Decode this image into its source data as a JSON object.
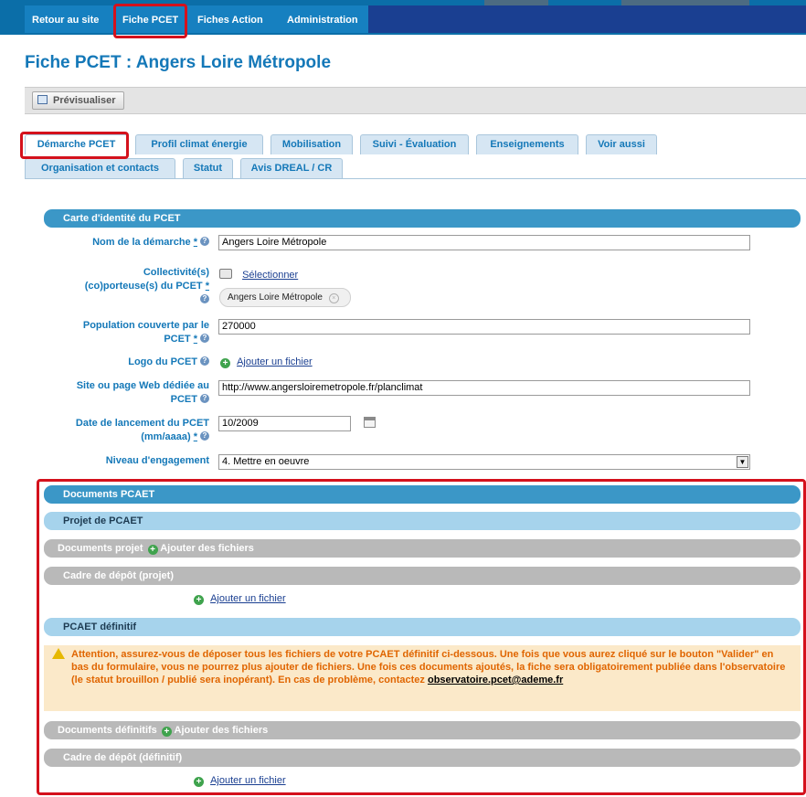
{
  "nav": {
    "items": [
      {
        "label": "Retour au site"
      },
      {
        "label": "Fiche PCET"
      },
      {
        "label": "Fiches Action"
      },
      {
        "label": "Administration"
      }
    ]
  },
  "page": {
    "title": "Fiche PCET : Angers Loire Métropole"
  },
  "toolbar": {
    "preview_label": "Prévisualiser"
  },
  "tabs": {
    "row1": [
      {
        "label": "Démarche PCET"
      },
      {
        "label": "Profil climat énergie"
      },
      {
        "label": "Mobilisation"
      },
      {
        "label": "Suivi - Évaluation"
      },
      {
        "label": "Enseignements"
      },
      {
        "label": "Voir aussi"
      }
    ],
    "row2": [
      {
        "label": "Organisation et contacts"
      },
      {
        "label": "Statut"
      },
      {
        "label": "Avis DREAL / CR"
      }
    ]
  },
  "identity": {
    "section_title": "Carte d'identité du PCET",
    "nom_label": "Nom de la démarche",
    "nom_value": "Angers Loire Métropole",
    "collectivite_label_1": "Collectivité(s)",
    "collectivite_label_2": "(co)porteuse(s) du PCET",
    "select_link": "Sélectionner",
    "collectivite_tag": "Angers Loire Métropole",
    "population_label_1": "Population couverte par le",
    "population_label_2": "PCET",
    "population_value": "270000",
    "logo_label": "Logo du PCET",
    "add_file_link": "Ajouter un fichier",
    "site_label_1": "Site ou page Web dédiée au",
    "site_label_2": "PCET",
    "site_value": "http://www.angersloiremetropole.fr/planclimat",
    "date_label_1": "Date de lancement du PCET",
    "date_label_2": "(mm/aaaa)",
    "date_value": "10/2009",
    "niveau_label": "Niveau d'engagement",
    "niveau_value": "4. Mettre en oeuvre",
    "required_mark": "*"
  },
  "documents": {
    "section_title": "Documents PCAET",
    "projet_title": "Projet de PCAET",
    "docs_projet": "Documents projet",
    "add_files": "Ajouter des fichiers",
    "cadre_projet": "Cadre de dépôt (projet)",
    "add_file": "Ajouter un fichier",
    "definitif_title": "PCAET définitif",
    "warning_text": "Attention, assurez-vous de déposer tous les fichiers de votre PCAET définitif ci-dessous. Une fois que vous aurez cliqué sur le bouton \"Valider\" en bas du formulaire, vous ne pourrez plus ajouter de fichiers. Une fois ces documents ajoutés, la fiche sera obligatoirement publiée dans l'observatoire (le statut brouillon / publié sera inopérant). En cas de problème, contactez",
    "warning_email": "observatoire.pcet@ademe.fr",
    "docs_definitifs": "Documents définitifs",
    "cadre_definitif": "Cadre de dépôt (définitif)"
  },
  "colors": {
    "nav_dark": "#1a3f91",
    "nav_light": "#1680c0",
    "title_blue": "#1478b8",
    "highlight_red": "#d4111c",
    "warning_orange": "#e06500"
  }
}
